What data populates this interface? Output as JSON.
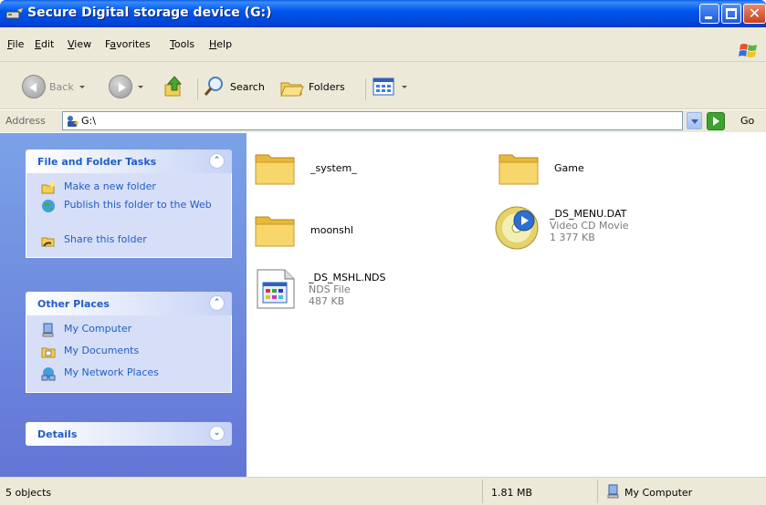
{
  "window": {
    "title": "Secure Digital storage device (G:)",
    "close_glyph": "✕"
  },
  "menu": [
    {
      "label": "File",
      "key": "F",
      "rest": "ile"
    },
    {
      "label": "Edit",
      "key": "E",
      "rest": "dit"
    },
    {
      "label": "View",
      "key": "V",
      "rest": "iew"
    },
    {
      "label": "Favorites",
      "key": "",
      "pre": "F",
      "mid": "a",
      "rest": "vorites"
    },
    {
      "label": "Tools",
      "key": "T",
      "rest": "ools"
    },
    {
      "label": "Help",
      "key": "H",
      "rest": "elp"
    }
  ],
  "toolbar": {
    "back_label": "Back",
    "search_label": "Search",
    "folders_label": "Folders"
  },
  "address": {
    "label": "Address",
    "value": "G:\\",
    "go_label": "Go"
  },
  "taskpane": {
    "file_tasks": {
      "title": "File and Folder Tasks",
      "items": [
        "Make a new folder",
        "Publish this folder to the Web",
        "Share this folder"
      ]
    },
    "other_places": {
      "title": "Other Places",
      "items": [
        "My Computer",
        "My Documents",
        "My Network Places"
      ]
    },
    "details": {
      "title": "Details"
    },
    "collapse_glyph": "⌃",
    "expand_glyph": "⌄"
  },
  "files": [
    {
      "name": "_system_",
      "kind": "folder"
    },
    {
      "name": "Game",
      "kind": "folder"
    },
    {
      "name": "moonshl",
      "kind": "folder"
    },
    {
      "name": "_DS_MENU.DAT",
      "kind": "video",
      "type": "Video CD Movie",
      "size": "1 377 KB"
    },
    {
      "name": "_DS_MSHL.NDS",
      "kind": "nds",
      "type": "NDS File",
      "size": "487 KB"
    }
  ],
  "status": {
    "objects": "5 objects",
    "size": "1.81 MB",
    "location": "My Computer"
  },
  "colors": {
    "titlebar": "#0058ee",
    "taskpane": "#7ba2e7",
    "link": "#215dc6"
  }
}
